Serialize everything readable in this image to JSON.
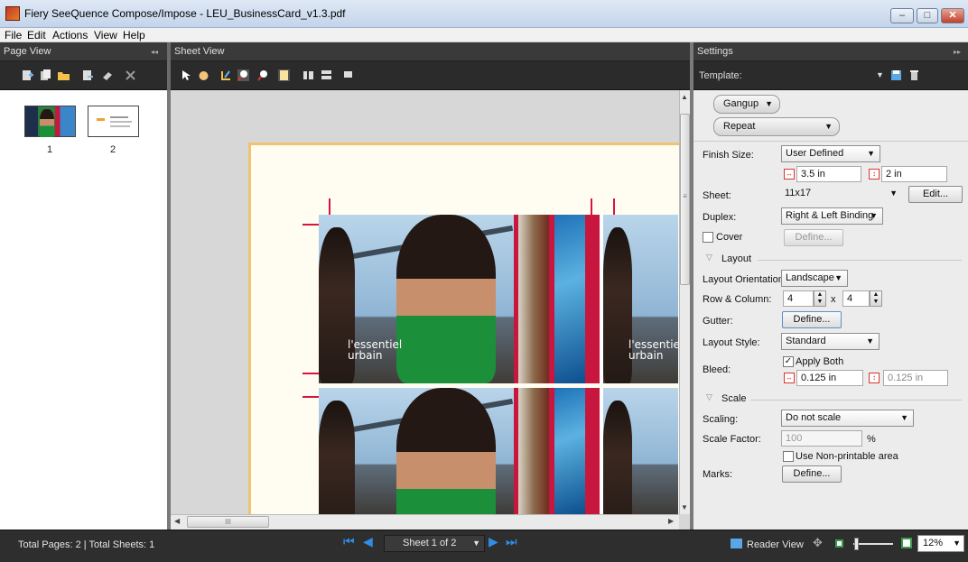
{
  "window": {
    "title": "Fiery SeeQuence Compose/Impose - LEU_BusinessCard_v1.3.pdf",
    "min": "–",
    "max": "□",
    "close": "✕"
  },
  "menu": [
    "File",
    "Edit",
    "Actions",
    "View",
    "Help"
  ],
  "page_view": {
    "title": "Page View",
    "collapse": "◂◂",
    "thumbs": [
      {
        "label": "1"
      },
      {
        "label": "2"
      }
    ]
  },
  "sheet_view": {
    "title": "Sheet View",
    "card_text_line1": "l'essentiel",
    "card_text_line2": "urbain",
    "hscroll_grip": "III",
    "vscroll_grip": "≡"
  },
  "settings": {
    "title": "Settings",
    "collapse": "▸▸",
    "template_label": "Template:",
    "gangup_label": "Gangup",
    "repeat_label": "Repeat",
    "finish_size_label": "Finish Size:",
    "finish_size_value": "User Defined",
    "finish_width": "3.5 in",
    "finish_height": "2 in",
    "sheet_label": "Sheet:",
    "sheet_value": "11x17",
    "edit_button": "Edit...",
    "duplex_label": "Duplex:",
    "duplex_value": "Right & Left Binding",
    "cover_label": "Cover",
    "define_label": "Define...",
    "layout_section": "Layout",
    "orientation_label": "Layout Orientation:",
    "orientation_value": "Landscape",
    "rowcol_label": "Row & Column:",
    "rows": "4",
    "x": "x",
    "cols": "4",
    "gutter_label": "Gutter:",
    "layout_style_label": "Layout Style:",
    "layout_style_value": "Standard",
    "apply_both_label": "Apply Both",
    "bleed_label": "Bleed:",
    "bleed_width": "0.125 in",
    "bleed_height": "0.125 in",
    "scale_section": "Scale",
    "scaling_label": "Scaling:",
    "scaling_value": "Do not scale",
    "scale_factor_label": "Scale Factor:",
    "scale_factor_value": "100",
    "percent": "%",
    "nonprintable_label": "Use Non-printable area",
    "marks_label": "Marks:"
  },
  "status": {
    "totals": "Total Pages: 2 | Total Sheets: 1",
    "sheet_indicator": "Sheet 1 of 2",
    "reader_view": "Reader View",
    "zoom": "12%"
  },
  "colors": {
    "accent_blue": "#2f8de4",
    "crop_red": "#d9133b",
    "sheet_border": "#f2c36e"
  }
}
